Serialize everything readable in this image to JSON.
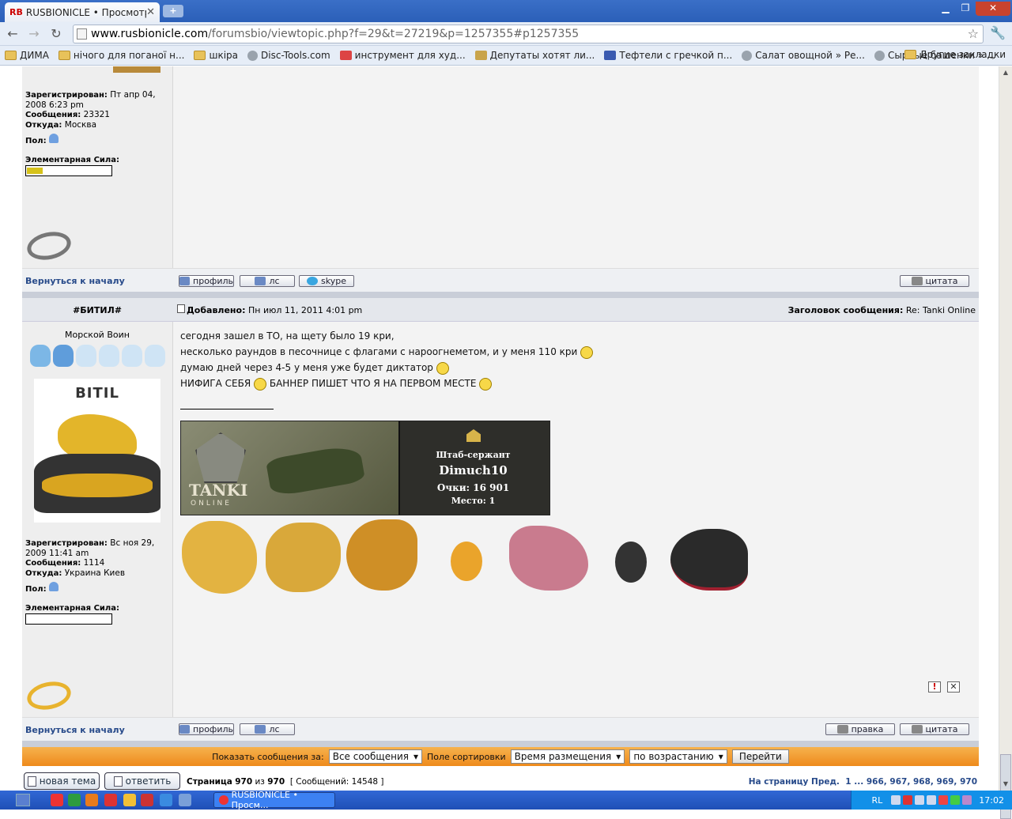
{
  "browser": {
    "tab_icon": "RB",
    "tab_title": "RUSBIONICLE • Просмотр те",
    "url_host": "www.rusbionicle.com",
    "url_path": "/forumsbio/viewtopic.php?f=29&t=27219&p=1257355#p1257355",
    "bookmarks": [
      {
        "label": "ДИМА",
        "icon": "folder-icon"
      },
      {
        "label": "нічого для поганої н...",
        "icon": "folder-icon"
      },
      {
        "label": "шкіра",
        "icon": "folder-icon"
      },
      {
        "label": "Disc-Tools.com",
        "icon": "globe-icon"
      },
      {
        "label": "инструмент для худ...",
        "icon": "red-icon"
      },
      {
        "label": "Депутаты хотят ли...",
        "icon": "page-icon"
      },
      {
        "label": "Тефтели с гречкой п...",
        "icon": "page-icon"
      },
      {
        "label": "Салат овощной » Ре...",
        "icon": "globe-icon"
      },
      {
        "label": "Сырные башенки » ...",
        "icon": "globe-icon"
      }
    ],
    "bookmarks_more": "»",
    "other_bookmarks": "Другие закладки"
  },
  "post1": {
    "registered_label": "Зарегистрирован:",
    "registered_value": "Пт апр 04, 2008 6:23 pm",
    "messages_label": "Сообщения:",
    "messages_value": "23321",
    "from_label": "Откуда:",
    "from_value": "Москва",
    "gender_label": "Пол:",
    "power_label": "Элементарная Сила:",
    "back_to_top": "Вернуться к началу",
    "buttons": {
      "profile": "профиль",
      "pm": "лс",
      "skype": "skype",
      "quote": "цитата"
    }
  },
  "post2": {
    "author": "#БИТИЛ#",
    "added_label": "Добавлено:",
    "added_value": "Пн июл 11, 2011 4:01 pm",
    "subject_label": "Заголовок сообщения:",
    "subject_value": "Re: Tanki Online",
    "rank": "Морской Воин",
    "avatar_text": "BITIL",
    "lines": [
      "сегодня зашел в ТО, на щету было 19 кри,",
      "несколько раундов в песочнице с флагами с нароогнеметом, и у меня 110 кри",
      "думаю дней через 4-5 у меня уже будет диктатор",
      "НИФИГА СЕБЯ",
      "БАННЕР ПИШЕТ ЧТО Я НА ПЕРВОМ МЕСТЕ"
    ],
    "banner": {
      "logo": "TANKI",
      "logo_sub": "ONLINE",
      "rank": "Штаб-сержант",
      "name": "Dimuch10",
      "points": "Очки: 16 901",
      "place": "Место: 1"
    },
    "registered_label": "Зарегистрирован:",
    "registered_value": "Вс ноя 29, 2009 11:41 am",
    "messages_label": "Сообщения:",
    "messages_value": "1114",
    "from_label": "Откуда:",
    "from_value": "Украина Киев",
    "gender_label": "Пол:",
    "power_label": "Элементарная Сила:",
    "back_to_top": "Вернуться к началу",
    "buttons": {
      "profile": "профиль",
      "pm": "лс",
      "edit": "правка",
      "quote": "цитата"
    }
  },
  "sortbar": {
    "show_label": "Показать сообщения за:",
    "show_value": "Все сообщения",
    "sort_label": "Поле сортировки",
    "sort_value": "Время размещения",
    "order_value": "по возрастанию",
    "go": "Перейти"
  },
  "bottom": {
    "new_topic": "новая тема",
    "reply": "ответить",
    "page_info_prefix": "Страница",
    "page_current": "970",
    "page_of": "из",
    "page_total": "970",
    "messages_count": "[ Сообщений: 14548 ]",
    "goto_label": "На страницу",
    "prev": "Пред.",
    "pages": "1 ... 966, 967, 968, 969, 970"
  },
  "taskbar": {
    "task_label": "RUSBIONICLE • Просм...",
    "lang": "RL",
    "clock": "17:02"
  },
  "colors": {
    "title_bar": "#2b5fb8",
    "link": "#274a8a",
    "sortbar": "#ee8a1c"
  }
}
